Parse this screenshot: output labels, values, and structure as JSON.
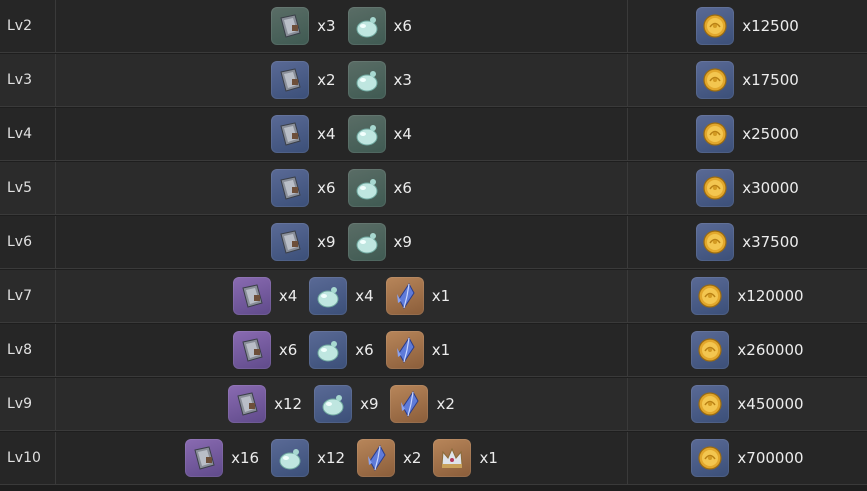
{
  "rows": [
    {
      "level": "Lv2",
      "materials": [
        {
          "icon": "mask-icon",
          "quality": "q2",
          "qty": "x3"
        },
        {
          "icon": "slime-icon",
          "quality": "q2",
          "qty": "x6"
        }
      ],
      "mora": {
        "icon": "mora-coin-icon",
        "qty": "x12500"
      }
    },
    {
      "level": "Lv3",
      "materials": [
        {
          "icon": "mask-icon",
          "quality": "q3",
          "qty": "x2"
        },
        {
          "icon": "slime-icon",
          "quality": "q2",
          "qty": "x3"
        }
      ],
      "mora": {
        "icon": "mora-coin-icon",
        "qty": "x17500"
      }
    },
    {
      "level": "Lv4",
      "materials": [
        {
          "icon": "mask-icon",
          "quality": "q3",
          "qty": "x4"
        },
        {
          "icon": "slime-icon",
          "quality": "q2",
          "qty": "x4"
        }
      ],
      "mora": {
        "icon": "mora-coin-icon",
        "qty": "x25000"
      }
    },
    {
      "level": "Lv5",
      "materials": [
        {
          "icon": "mask-icon",
          "quality": "q3",
          "qty": "x6"
        },
        {
          "icon": "slime-icon",
          "quality": "q2",
          "qty": "x6"
        }
      ],
      "mora": {
        "icon": "mora-coin-icon",
        "qty": "x30000"
      }
    },
    {
      "level": "Lv6",
      "materials": [
        {
          "icon": "mask-icon",
          "quality": "q3",
          "qty": "x9"
        },
        {
          "icon": "slime-icon",
          "quality": "q2",
          "qty": "x9"
        }
      ],
      "mora": {
        "icon": "mora-coin-icon",
        "qty": "x37500"
      }
    },
    {
      "level": "Lv7",
      "materials": [
        {
          "icon": "mask-icon",
          "quality": "q4",
          "qty": "x4"
        },
        {
          "icon": "slime-icon",
          "quality": "q3",
          "qty": "x4"
        },
        {
          "icon": "crystal-icon",
          "quality": "q5",
          "qty": "x1"
        }
      ],
      "mora": {
        "icon": "mora-coin-icon",
        "qty": "x120000"
      }
    },
    {
      "level": "Lv8",
      "materials": [
        {
          "icon": "mask-icon",
          "quality": "q4",
          "qty": "x6"
        },
        {
          "icon": "slime-icon",
          "quality": "q3",
          "qty": "x6"
        },
        {
          "icon": "crystal-icon",
          "quality": "q5",
          "qty": "x1"
        }
      ],
      "mora": {
        "icon": "mora-coin-icon",
        "qty": "x260000"
      }
    },
    {
      "level": "Lv9",
      "materials": [
        {
          "icon": "mask-icon",
          "quality": "q4",
          "qty": "x12"
        },
        {
          "icon": "slime-icon",
          "quality": "q3",
          "qty": "x9"
        },
        {
          "icon": "crystal-icon",
          "quality": "q5",
          "qty": "x2"
        }
      ],
      "mora": {
        "icon": "mora-coin-icon",
        "qty": "x450000"
      }
    },
    {
      "level": "Lv10",
      "materials": [
        {
          "icon": "mask-icon",
          "quality": "q4",
          "qty": "x16"
        },
        {
          "icon": "slime-icon",
          "quality": "q3",
          "qty": "x12"
        },
        {
          "icon": "crystal-icon",
          "quality": "q5",
          "qty": "x2"
        },
        {
          "icon": "crown-icon",
          "quality": "q5",
          "qty": "x1"
        }
      ],
      "mora": {
        "icon": "mora-coin-icon",
        "qty": "x700000"
      }
    }
  ],
  "colors": {
    "background": "#1e1e1e",
    "row_odd": "#262626",
    "row_even": "#2b2b2b",
    "divider": "#3a3a3a",
    "text": "#e8e8e8"
  }
}
